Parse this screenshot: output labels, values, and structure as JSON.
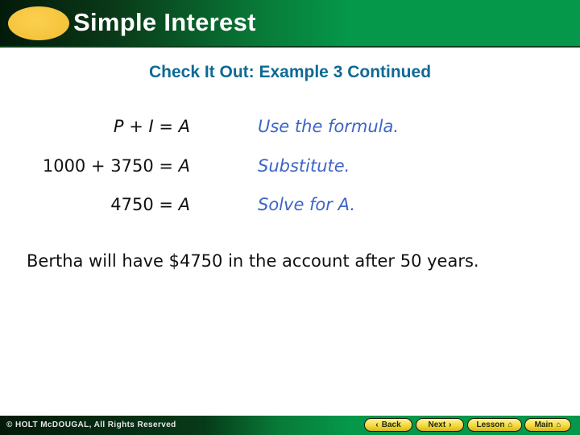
{
  "header": {
    "title": "Simple Interest"
  },
  "subtitle": "Check It Out: Example 3 Continued",
  "steps": [
    {
      "equation_parts": [
        "P",
        " + ",
        "I",
        " = ",
        "A"
      ],
      "note": "Use the formula."
    },
    {
      "equation_parts": [
        "1000 + 3750 = ",
        "A"
      ],
      "note": "Substitute."
    },
    {
      "equation_parts": [
        "4750 = ",
        "A"
      ],
      "note": "Solve for A."
    }
  ],
  "conclusion": "Bertha will have $4750 in the account after 50 years.",
  "footer": {
    "copyright": "© HOLT McDOUGAL, All Rights Reserved",
    "nav": {
      "back_label": "Back",
      "back_icon": "‹",
      "next_label": "Next",
      "next_icon": "›",
      "lesson_label": "Lesson",
      "main_label": "Main",
      "home_icon": "⌂"
    }
  }
}
